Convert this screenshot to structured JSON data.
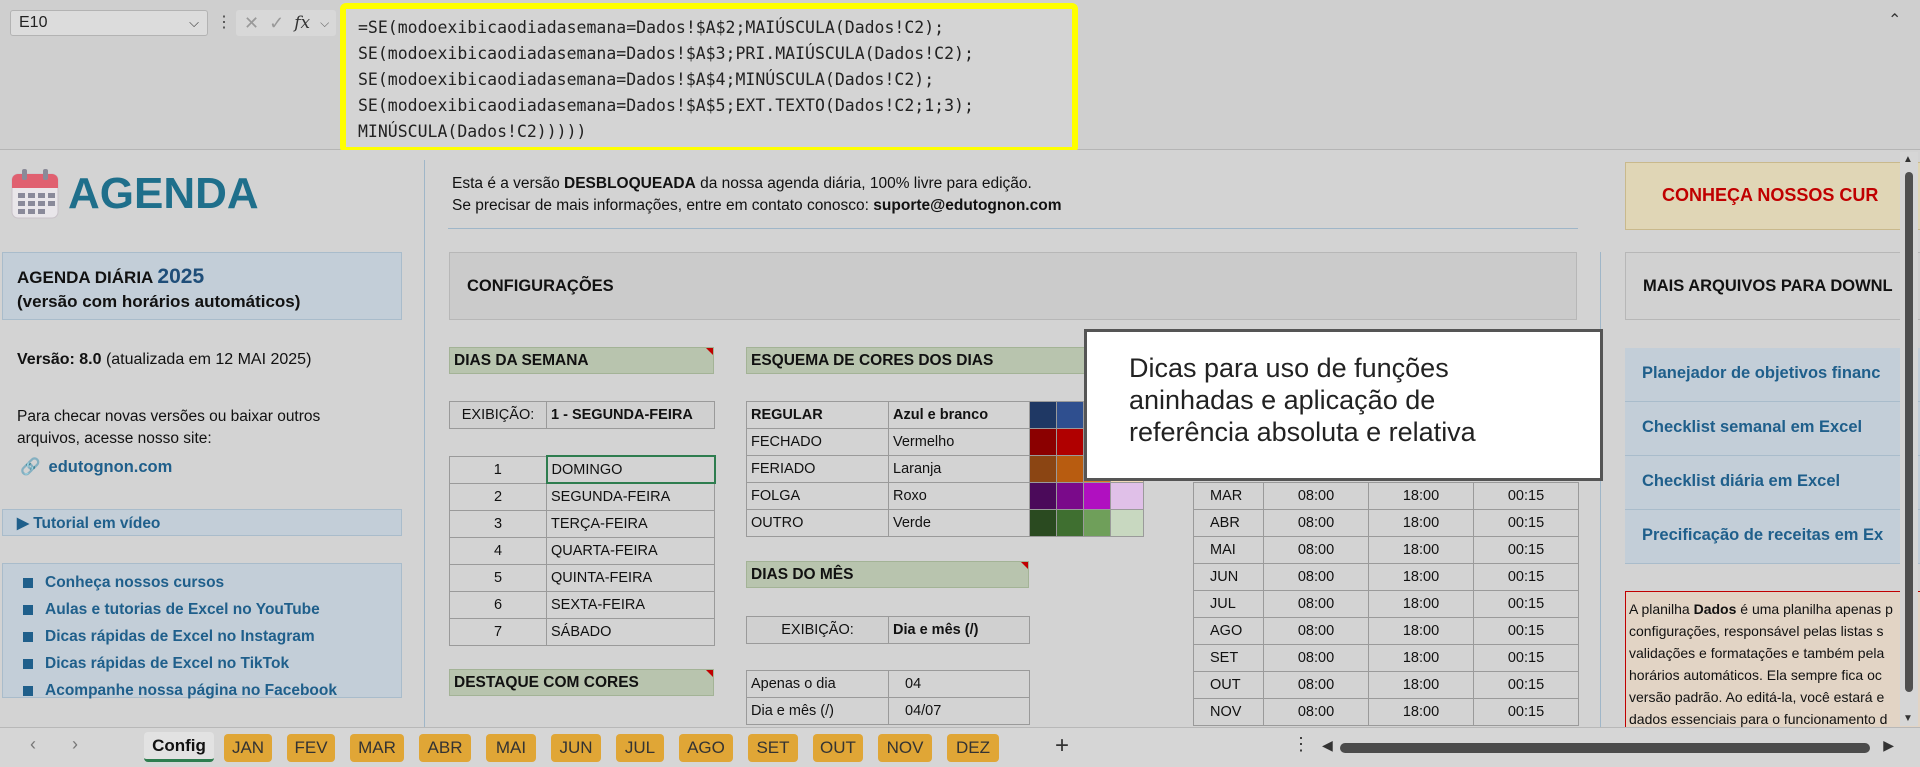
{
  "formula_bar": {
    "name_box": "E10",
    "fx": "fx",
    "formula_lines": [
      "=SE(modoexibicaodiadasemana=Dados!$A$2;MAIÚSCULA(Dados!C2);",
      "SE(modoexibicaodiadasemana=Dados!$A$3;PRI.MAIÚSCULA(Dados!C2);",
      "SE(modoexibicaodiadasemana=Dados!$A$4;MINÚSCULA(Dados!C2);",
      "SE(modoexibicaodiadasemana=Dados!$A$5;EXT.TEXTO(Dados!C2;1;3);",
      "MINÚSCULA(Dados!C2)))))"
    ]
  },
  "left_panel": {
    "logo_text": "AGENDA",
    "title_line1": "AGENDA DIÁRIA",
    "title_year": "2025",
    "title_line2": "(versão com horários automáticos)",
    "version_label": "Versão: 8.0",
    "version_note": "(atualizada em 12 MAI 2025)",
    "check_text": "Para checar novas versões ou baixar outros arquivos, acesse nosso site:",
    "site": "edutognon.com",
    "tutorial": "▶ Tutorial em vídeo",
    "links": [
      "Conheça nossos cursos",
      "Aulas e tutorias de Excel no YouTube",
      "Dicas rápidas de Excel no Instagram",
      "Dicas rápidas de Excel no TikTok",
      "Acompanhe nossa página no Facebook"
    ]
  },
  "intro": {
    "pre": "Esta é a versão ",
    "bold": "DESBLOQUEADA",
    "post": " da nossa agenda diária, 100% livre para edição.",
    "line2_pre": "Se precisar de mais informações, entre em contato conosco: ",
    "email": "suporte@edutognon.com"
  },
  "config": {
    "title": "CONFIGURAÇÕES",
    "days_section": "DIAS DA SEMANA",
    "exib_label": "EXIBIÇÃO:",
    "exib_value": "1 - SEGUNDA-FEIRA",
    "days": [
      {
        "n": "1",
        "name": "DOMINGO"
      },
      {
        "n": "2",
        "name": "SEGUNDA-FEIRA"
      },
      {
        "n": "3",
        "name": "TERÇA-FEIRA"
      },
      {
        "n": "4",
        "name": "QUARTA-FEIRA"
      },
      {
        "n": "5",
        "name": "QUINTA-FEIRA"
      },
      {
        "n": "6",
        "name": "SEXTA-FEIRA"
      },
      {
        "n": "7",
        "name": "SÁBADO"
      }
    ],
    "highlight_section": "DESTAQUE COM CORES",
    "colors_section": "ESQUEMA DE CORES DOS DIAS",
    "color_rows": [
      {
        "type": "REGULAR",
        "scheme": "Azul e branco",
        "swatches": [
          "#1f3864",
          "#2f4f8f",
          "#3a5fa8",
          "#d8dde8"
        ]
      },
      {
        "type": "FECHADO",
        "scheme": "Vermelho",
        "swatches": [
          "#8b0000",
          "#b00000",
          "#d03030",
          "#f0c8c8"
        ]
      },
      {
        "type": "FERIADO",
        "scheme": "Laranja",
        "swatches": [
          "#8b4513",
          "#b85c10",
          "#d87a20",
          "#f0d8b8"
        ]
      },
      {
        "type": "FOLGA",
        "scheme": "Roxo",
        "swatches": [
          "#4b0a5a",
          "#7a0a8a",
          "#b010c0",
          "#e0c0e8"
        ]
      },
      {
        "type": "OUTRO",
        "scheme": "Verde",
        "swatches": [
          "#2a4a20",
          "#3f6f30",
          "#6f9f5a",
          "#c8d8c0"
        ]
      }
    ],
    "month_days_section": "DIAS DO MÊS",
    "month_exib_label": "EXIBIÇÃO:",
    "month_exib_value": "Dia e mês (/)",
    "month_options": [
      {
        "label": "Apenas o dia",
        "value": "04"
      },
      {
        "label": "Dia e mês (/)",
        "value": "04/07"
      }
    ],
    "schedule": [
      {
        "m": "MAR",
        "a": "08:00",
        "b": "18:00",
        "c": "00:15"
      },
      {
        "m": "ABR",
        "a": "08:00",
        "b": "18:00",
        "c": "00:15"
      },
      {
        "m": "MAI",
        "a": "08:00",
        "b": "18:00",
        "c": "00:15"
      },
      {
        "m": "JUN",
        "a": "08:00",
        "b": "18:00",
        "c": "00:15"
      },
      {
        "m": "JUL",
        "a": "08:00",
        "b": "18:00",
        "c": "00:15"
      },
      {
        "m": "AGO",
        "a": "08:00",
        "b": "18:00",
        "c": "00:15"
      },
      {
        "m": "SET",
        "a": "08:00",
        "b": "18:00",
        "c": "00:15"
      },
      {
        "m": "OUT",
        "a": "08:00",
        "b": "18:00",
        "c": "00:15"
      },
      {
        "m": "NOV",
        "a": "08:00",
        "b": "18:00",
        "c": "00:15"
      }
    ]
  },
  "right_panel": {
    "courses_button": "CONHEÇA NOSSOS CUR",
    "more_files": "MAIS ARQUIVOS PARA DOWNL",
    "file_links": [
      "Planejador de objetivos financ",
      "Checklist semanal em Excel",
      "Checklist diária em Excel",
      "Precificação de receitas em Ex"
    ],
    "note_pre": "A planilha ",
    "note_bold": "Dados",
    "note_post": " é uma planilha apenas p configurações, responsável pelas listas s validações e formatações e também pela horários automáticos. Ela sempre fica oc versão padrão. Ao editá-la, você estará e dados essenciais para o funcionamento d"
  },
  "callout": "Dicas para uso de funções aninhadas e aplicação de referência absoluta e relativa",
  "tabs": {
    "active": "Config",
    "months": [
      "JAN",
      "FEV",
      "MAR",
      "ABR",
      "MAI",
      "JUN",
      "JUL",
      "AGO",
      "SET",
      "OUT",
      "NOV",
      "DEZ"
    ],
    "add": "+"
  }
}
